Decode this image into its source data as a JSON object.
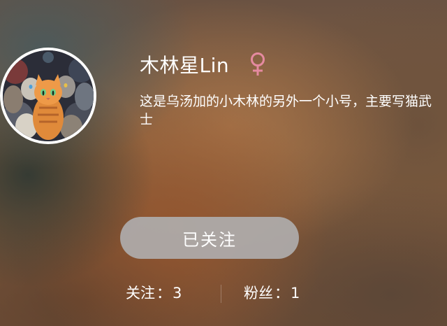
{
  "profile": {
    "name": "木林星Lin",
    "gender": "♀",
    "gender_color": "#e58aa0",
    "bio": "这是乌汤加的小木林的另外一个小号，主要写猫武士",
    "avatar_icon": "warrior-cats-avatar"
  },
  "follow_button": {
    "label": "已关注",
    "state": "following"
  },
  "stats": {
    "following_label": "关注",
    "following_separator": "：",
    "following_count": "3",
    "followers_label": "粉丝",
    "followers_separator": "：",
    "followers_count": "1"
  }
}
